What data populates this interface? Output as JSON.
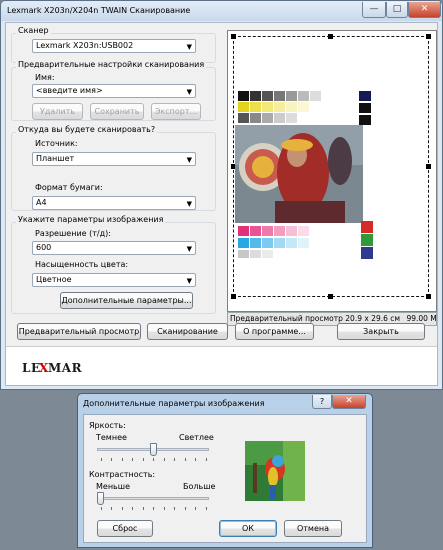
{
  "window": {
    "title": "Lexmark X203n/X204n TWAIN Сканирование",
    "minimize": "—",
    "maximize": "□",
    "close": "✕"
  },
  "scanner_group": {
    "label": "Сканер",
    "device": "Lexmark X203n:USB002"
  },
  "presets_group": {
    "label": "Предварительные настройки сканирования",
    "name_label": "Имя:",
    "name_value": "<введите имя>",
    "delete_label": "Удалить",
    "save_label": "Сохранить",
    "export_label": "Экспорт..."
  },
  "source_group": {
    "label": "Откуда вы будете сканировать?",
    "source_label": "Источник:",
    "source_value": "Планшет",
    "paper_label": "Формат бумаги:",
    "paper_value": "A4"
  },
  "image_group": {
    "label": "Укажите параметры изображения",
    "resolution_label": "Разрешение (т/д):",
    "resolution_value": "600",
    "color_label": "Насыщенность цвета:",
    "color_value": "Цветное",
    "advanced_label": "Дополнительные параметры..."
  },
  "preview": {
    "status_left": "Предварительный просмотр",
    "status_size": "20.9 x 29.6 см",
    "status_mb": "99.00 Мбайт"
  },
  "buttons": {
    "preview": "Предварительный просмотр",
    "scan": "Сканирование",
    "about": "О программе...",
    "close": "Закрыть"
  },
  "logo": "LEXMARK",
  "dialog": {
    "title": "Дополнительные параметры изображения",
    "help": "?",
    "close": "✕",
    "brightness_label": "Яркость:",
    "brightness_min": "Темнее",
    "brightness_max": "Светлее",
    "brightness_value": 0.5,
    "contrast_label": "Контрастность:",
    "contrast_min": "Меньше",
    "contrast_max": "Больше",
    "contrast_value": 0.0,
    "reset_label": "Сброс",
    "ok_label": "ОК",
    "cancel_label": "Отмена"
  }
}
